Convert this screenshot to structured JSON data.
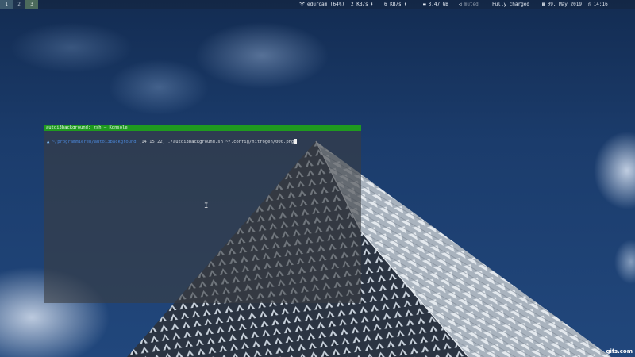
{
  "workspaces": [
    {
      "label": "1",
      "active": true
    },
    {
      "label": "2",
      "active": false
    },
    {
      "label": "3",
      "active": false
    }
  ],
  "statusbar": {
    "wifi": {
      "icon": "wifi-icon",
      "text": "eduroam (64%)"
    },
    "download": {
      "icon": "download-icon",
      "text": "2 KB/s"
    },
    "upload": {
      "icon": "upload-icon",
      "text": "6 KB/s"
    },
    "memory": {
      "icon": "memory-icon",
      "text": "3.47 GB"
    },
    "volume": {
      "icon": "volume-mute-icon",
      "text": "muted"
    },
    "battery": {
      "text": "Fully charged"
    },
    "date": {
      "icon": "calendar-icon",
      "text": "09. May 2019"
    },
    "time": {
      "icon": "clock-icon",
      "text": "14:16"
    }
  },
  "terminal": {
    "title": "autoi3background: zsh — Konsole",
    "prompt_arrow": "▲",
    "prompt_path": "~/programmieren/autoi3background",
    "prompt_time": "[14:15:22]",
    "command": "./autoi3background.sh ~/.config/nitrogen/000.png"
  },
  "watermark": "gifs.com",
  "colors": {
    "title_bar_green": "#1f9a1f",
    "path_blue": "#4a86d8"
  }
}
